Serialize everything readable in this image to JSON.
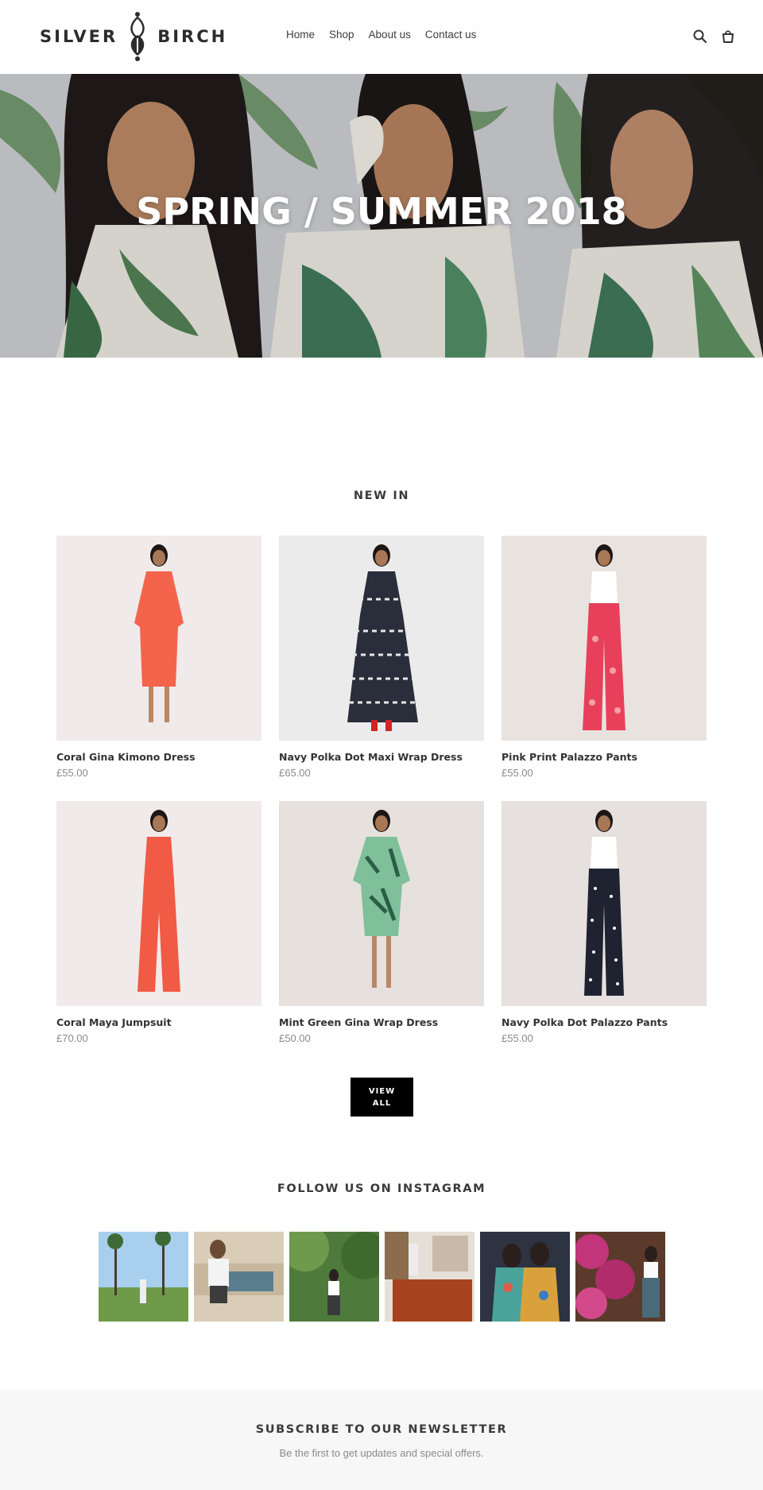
{
  "brand": {
    "name_left": "SILVER",
    "name_right": "BIRCH"
  },
  "nav": {
    "items": [
      {
        "label": "Home"
      },
      {
        "label": "Shop"
      },
      {
        "label": "About us"
      },
      {
        "label": "Contact us"
      }
    ]
  },
  "header_icons": [
    "search-icon",
    "cart-icon"
  ],
  "hero": {
    "title": "SPRING / SUMMER 2018"
  },
  "new_in": {
    "heading": "NEW IN",
    "products": [
      {
        "name": "Coral Gina Kimono Dress",
        "price": "£55.00",
        "garment_color": "#f4644d"
      },
      {
        "name": "Navy Polka Dot Maxi Wrap Dress",
        "price": "£65.00",
        "garment_color": "#2a2d3a"
      },
      {
        "name": "Pink Print Palazzo Pants",
        "price": "£55.00",
        "garment_color": "#e8405a"
      },
      {
        "name": "Coral Maya Jumpsuit",
        "price": "£70.00",
        "garment_color": "#f15a44"
      },
      {
        "name": "Mint Green Gina Wrap Dress",
        "price": "£50.00",
        "garment_color": "#7fbf9a"
      },
      {
        "name": "Navy Polka Dot Palazzo Pants",
        "price": "£55.00",
        "garment_color": "#1f2230"
      }
    ],
    "view_all_label": "VIEW ALL"
  },
  "instagram": {
    "heading": "FOLLOW US ON INSTAGRAM"
  },
  "newsletter": {
    "heading": "SUBSCRIBE TO OUR NEWSLETTER",
    "subtext": "Be the first to get updates and special offers."
  },
  "colors": {
    "accent": "#000000",
    "text": "#3a3a3a",
    "muted": "#8a8a8a",
    "footer_bg": "#f7f7f7"
  }
}
